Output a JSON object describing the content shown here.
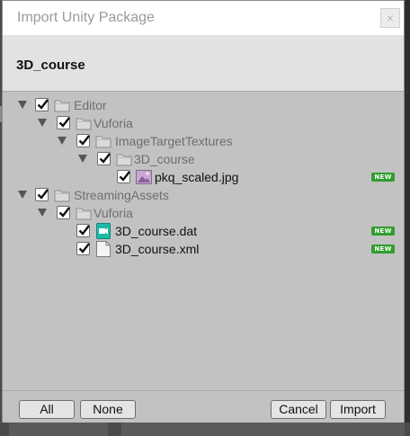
{
  "dialog": {
    "title": "Import Unity Package",
    "close_symbol": "×",
    "package_name": "3D_course"
  },
  "tree": {
    "items": [
      {
        "label": "Editor",
        "type": "folder",
        "checked": true,
        "expanded": true,
        "is_new": false
      },
      {
        "label": "Vuforia",
        "type": "folder",
        "checked": true,
        "expanded": true,
        "is_new": false
      },
      {
        "label": "ImageTargetTextures",
        "type": "folder",
        "checked": true,
        "expanded": true,
        "is_new": false
      },
      {
        "label": "3D_course",
        "type": "folder",
        "checked": true,
        "expanded": true,
        "is_new": false
      },
      {
        "label": "pkq_scaled.jpg",
        "type": "image-file",
        "checked": true,
        "is_new": true
      },
      {
        "label": "StreamingAssets",
        "type": "folder",
        "checked": true,
        "expanded": true,
        "is_new": false
      },
      {
        "label": "Vuforia",
        "type": "folder",
        "checked": true,
        "expanded": true,
        "is_new": false
      },
      {
        "label": "3D_course.dat",
        "type": "data-file",
        "checked": true,
        "is_new": true
      },
      {
        "label": "3D_course.xml",
        "type": "text-file",
        "checked": true,
        "is_new": true
      }
    ],
    "new_badge": "NEW"
  },
  "footer": {
    "all_label": "All",
    "none_label": "None",
    "cancel_label": "Cancel",
    "import_label": "Import"
  },
  "colors": {
    "panel_background": "#c2c2c2",
    "header_background": "#e2e2e2",
    "new_badge": "#2e9e2e",
    "folder_label": "#6e6e6e"
  }
}
